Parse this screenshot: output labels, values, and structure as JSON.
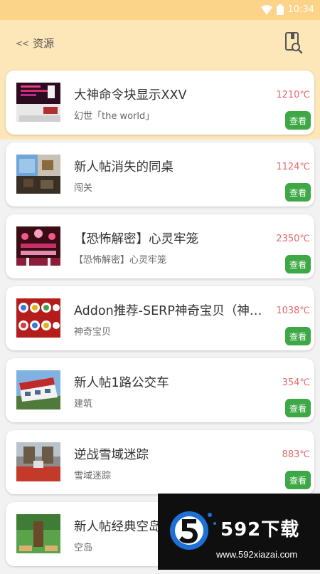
{
  "status_bar": {
    "time": "10:34"
  },
  "header": {
    "back_label": "资源"
  },
  "items": [
    {
      "title": "大神命令块显示XXV",
      "subtitle": "幻世「the world」",
      "temperature": "1210℃",
      "view_label": "查看"
    },
    {
      "title": "新人帖消失的同桌",
      "subtitle": "闯关",
      "temperature": "1124℃",
      "view_label": "查看"
    },
    {
      "title": "【恐怖解密】心灵牢笼",
      "subtitle": "【恐怖解密】心灵牢笼",
      "temperature": "2350℃",
      "view_label": "查看"
    },
    {
      "title": "Addon推荐-SERP神奇宝贝（神奇宝...",
      "subtitle": "神奇宝贝",
      "temperature": "1038℃",
      "view_label": "查看"
    },
    {
      "title": "新人帖1路公交车",
      "subtitle": "建筑",
      "temperature": "354℃",
      "view_label": "查看"
    },
    {
      "title": "逆战雪域迷踪",
      "subtitle": "雪域迷踪",
      "temperature": "883℃",
      "view_label": "查看"
    },
    {
      "title": "新人帖经典空岛",
      "subtitle": "空岛",
      "temperature": "",
      "view_label": ""
    }
  ],
  "watermark": {
    "brand": "592下载",
    "url": "www.592xiazai.com"
  },
  "colors": {
    "header_bg": "#fde6b8",
    "status_bg": "#fbd389",
    "button_green": "#3fa846",
    "temp_red": "#e46a6a"
  }
}
